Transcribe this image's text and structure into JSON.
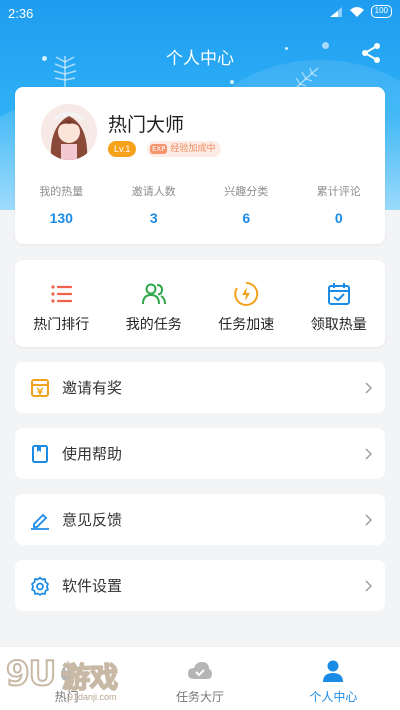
{
  "status_bar": {
    "time": "2:36",
    "battery": "100"
  },
  "header": {
    "title": "个人中心"
  },
  "profile": {
    "username": "热门大师",
    "level": "Lv.1",
    "exp_badge": "经验加成中",
    "exp_tag": "EXP",
    "stats": [
      {
        "label": "我的热量",
        "value": "130"
      },
      {
        "label": "邀请人数",
        "value": "3"
      },
      {
        "label": "兴趣分类",
        "value": "6"
      },
      {
        "label": "累计评论",
        "value": "0"
      }
    ]
  },
  "actions": [
    {
      "label": "热门排行",
      "icon": "list-icon",
      "color": "#f0604a"
    },
    {
      "label": "我的任务",
      "icon": "users-icon",
      "color": "#2ea84a"
    },
    {
      "label": "任务加速",
      "icon": "lightning-icon",
      "color": "#f2a21c"
    },
    {
      "label": "领取热量",
      "icon": "calendar-check-icon",
      "color": "#1b8be6"
    }
  ],
  "menu": [
    {
      "label": "邀请有奖",
      "icon": "gift-card-icon",
      "color": "#f2a21c"
    },
    {
      "label": "使用帮助",
      "icon": "book-icon",
      "color": "#1b8be6"
    },
    {
      "label": "意见反馈",
      "icon": "edit-icon",
      "color": "#1b8be6"
    },
    {
      "label": "软件设置",
      "icon": "gear-icon",
      "color": "#1b8be6"
    }
  ],
  "tabs": [
    {
      "label": "热门",
      "icon": "fire-icon",
      "active": false
    },
    {
      "label": "任务大厅",
      "icon": "cloud-icon",
      "active": false
    },
    {
      "label": "个人中心",
      "icon": "person-icon",
      "active": true
    }
  ],
  "watermark": {
    "number": "9U",
    "text": "游戏",
    "url": "91danji.com"
  },
  "colors": {
    "primary": "#1b8be6",
    "background": "#f3f4f6",
    "header_gradient_top": "#1e9cf0"
  }
}
